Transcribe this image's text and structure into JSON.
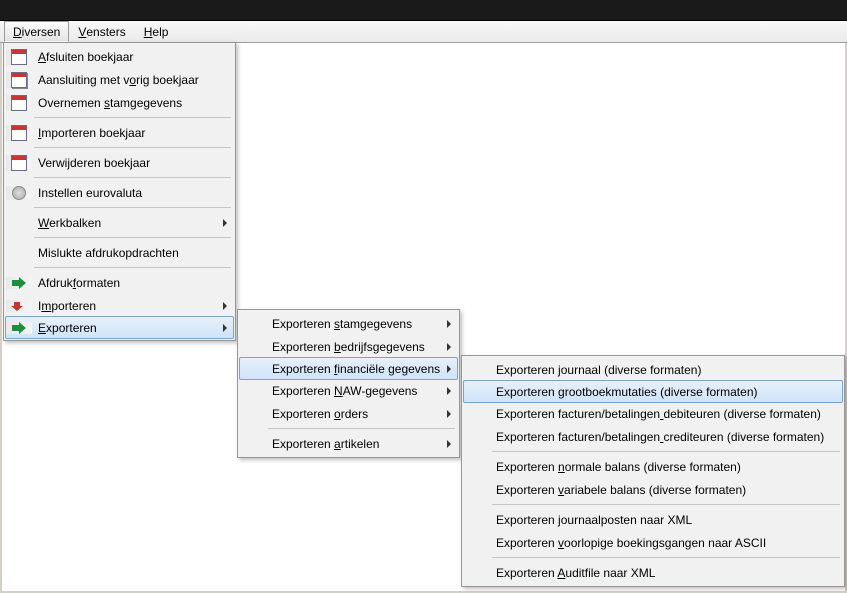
{
  "menubar": {
    "items": [
      {
        "label": "Diversen",
        "mn": 0
      },
      {
        "label": "Vensters",
        "mn": 0
      },
      {
        "label": "Help",
        "mn": 0
      }
    ],
    "activeIndex": 0
  },
  "menu1": {
    "items": [
      {
        "label": "Afsluiten boekjaar",
        "mn": 0,
        "icon": "cal"
      },
      {
        "label": "Aansluiting met vorig boekjaar",
        "mn": 17,
        "icon": "cal2"
      },
      {
        "label": "Overnemen stamgegevens",
        "mn": 10,
        "icon": "cal"
      },
      {
        "sep": true
      },
      {
        "label": "Importeren boekjaar",
        "mn": 0,
        "icon": "cal"
      },
      {
        "sep": true
      },
      {
        "label": "Verwijderen boekjaar",
        "mn": -1,
        "icon": "cal"
      },
      {
        "sep": true
      },
      {
        "label": "Instellen eurovaluta",
        "mn": -1,
        "icon": "gear"
      },
      {
        "sep": true
      },
      {
        "label": "Werkbalken",
        "mn": 0,
        "sub": true
      },
      {
        "sep": true
      },
      {
        "label": "Mislukte afdrukopdrachten",
        "mn": -1
      },
      {
        "sep": true
      },
      {
        "label": "Afdrukformaten",
        "mn": 6,
        "iconArrow": "green-right"
      },
      {
        "label": "Importeren",
        "mn": 1,
        "sub": true,
        "iconArrow": "red-down"
      },
      {
        "label": "Exporteren",
        "mn": 0,
        "sub": true,
        "highlight": true,
        "iconArrow": "green-right"
      }
    ]
  },
  "menu2": {
    "items": [
      {
        "label": "Exporteren stamgegevens",
        "mn": 11,
        "sub": true
      },
      {
        "label": "Exporteren bedrijfsgegevens",
        "mn": 11,
        "sub": true
      },
      {
        "label": "Exporteren financiële gegevens",
        "mn": 11,
        "sub": true,
        "highlight": true
      },
      {
        "label": "Exporteren NAW-gegevens",
        "mn": 11,
        "sub": true
      },
      {
        "label": "Exporteren orders",
        "mn": 11,
        "sub": true
      },
      {
        "sep": true
      },
      {
        "label": "Exporteren artikelen",
        "mn": 11,
        "sub": true
      }
    ]
  },
  "menu3": {
    "items": [
      {
        "label": "Exporteren journaal (diverse formaten)",
        "mn": 11
      },
      {
        "label": "Exporteren grootboekmutaties (diverse formaten)",
        "mn": 11,
        "highlight": true
      },
      {
        "label": "Exporteren facturen/betalingen debiteuren (diverse formaten)",
        "mn": 30
      },
      {
        "label": "Exporteren facturen/betalingen crediteuren (diverse formaten)",
        "mn": 30
      },
      {
        "sep": true
      },
      {
        "label": "Exporteren normale balans (diverse formaten)",
        "mn": 11
      },
      {
        "label": "Exporteren variabele balans (diverse formaten)",
        "mn": 11
      },
      {
        "sep": true
      },
      {
        "label": "Exporteren journaalposten naar XML",
        "mn": 11
      },
      {
        "label": "Exporteren voorlopige boekingsgangen naar ASCII",
        "mn": 11
      },
      {
        "sep": true
      },
      {
        "label": "Exporteren Auditfile naar XML",
        "mn": 11
      }
    ]
  }
}
